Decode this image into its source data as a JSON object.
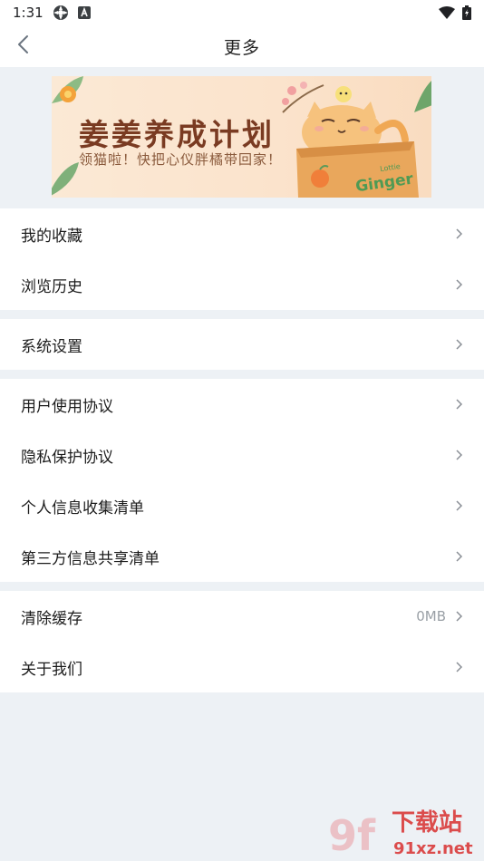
{
  "status_bar": {
    "time": "1:31"
  },
  "nav": {
    "title": "更多"
  },
  "banner": {
    "title": "姜姜养成计划",
    "subtitle": "领猫啦！快把心仪胖橘带回家！",
    "box_text": "Ginger",
    "box_small": "Lottie"
  },
  "groups": [
    {
      "items": [
        {
          "label": "我的收藏"
        },
        {
          "label": "浏览历史"
        }
      ]
    },
    {
      "items": [
        {
          "label": "系统设置"
        }
      ]
    },
    {
      "items": [
        {
          "label": "用户使用协议"
        },
        {
          "label": "隐私保护协议"
        },
        {
          "label": "个人信息收集清单"
        },
        {
          "label": "第三方信息共享清单"
        }
      ]
    },
    {
      "items": [
        {
          "label": "清除缓存",
          "value": "0MB"
        },
        {
          "label": "关于我们"
        }
      ]
    }
  ],
  "watermark": {
    "brand": "下载站",
    "url": "91xz.net",
    "logo": "9f"
  },
  "colors": {
    "accent": "#f0923a",
    "background": "#edf1f5",
    "chevron": "#8a8f96"
  },
  "icons": [
    "wifi-icon",
    "battery-icon",
    "back-arrow-icon",
    "chevron-right-icon"
  ]
}
